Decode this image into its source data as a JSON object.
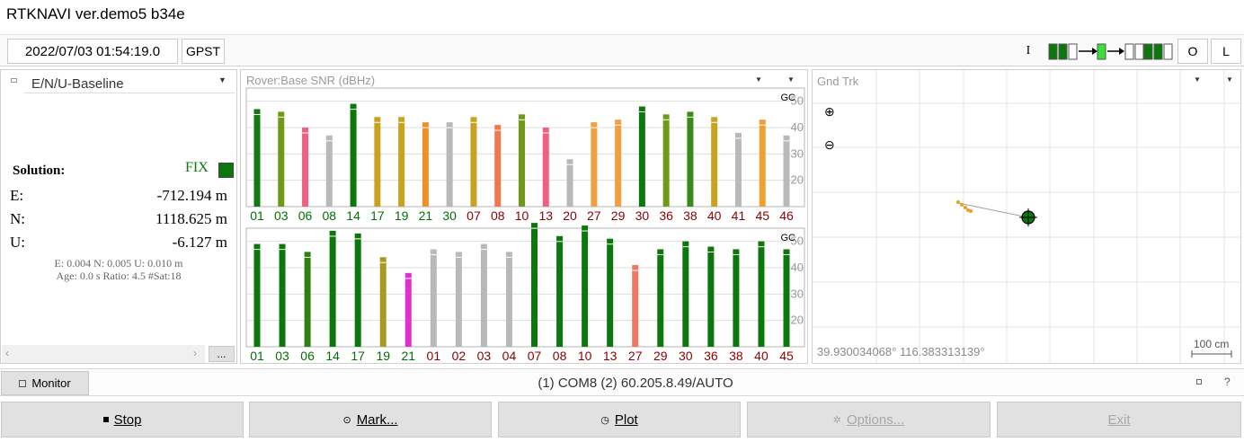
{
  "window": {
    "title": "RTKNAVI ver.demo5 b34e"
  },
  "toolbar": {
    "datetime": "2022/07/03 01:54:19.0",
    "time_system": "GPST",
    "input_label": "I",
    "output_label": "O",
    "log_label": "L"
  },
  "left_panel": {
    "mode": "E/N/U-Baseline",
    "solution_label": "Solution:",
    "status": "FIX",
    "status_color": "#008000",
    "rows": [
      {
        "label": "E:",
        "value": "-712.194 m"
      },
      {
        "label": "N:",
        "value": "1118.625 m"
      },
      {
        "label": "U:",
        "value": "-6.127 m"
      }
    ],
    "stats1": "E: 0.004 N: 0.005 U: 0.010 m",
    "stats2": "Age: 0.0 s Ratio: 4.5 #Sat:18",
    "more_button": "..."
  },
  "snr_panel": {
    "title": "Rover:Base  SNR (dBHz)",
    "chart_data": [
      {
        "type": "bar",
        "title": "GC",
        "ylim": [
          10,
          55
        ],
        "yticks": [
          20,
          30,
          40,
          50
        ],
        "categories": [
          "01",
          "03",
          "06",
          "08",
          "14",
          "17",
          "19",
          "21",
          "30",
          "07",
          "08",
          "10",
          "13",
          "20",
          "27",
          "29",
          "30",
          "36",
          "38",
          "40",
          "41",
          "45",
          "46"
        ],
        "label_colors": [
          "#007000",
          "#007000",
          "#007000",
          "#007000",
          "#007000",
          "#007000",
          "#007000",
          "#007000",
          "#007000",
          "#8b0000",
          "#8b0000",
          "#8b0000",
          "#8b0000",
          "#8b0000",
          "#8b0000",
          "#8b0000",
          "#8b0000",
          "#8b0000",
          "#8b0000",
          "#8b0000",
          "#8b0000",
          "#8b0000",
          "#8b0000"
        ],
        "values": [
          47,
          46,
          40,
          37,
          49,
          44,
          44,
          42,
          42,
          44,
          41,
          45,
          40,
          28,
          42,
          43,
          48,
          45,
          46,
          44,
          38,
          43,
          37
        ],
        "bar_colors": [
          "#127812",
          "#6f9a18",
          "#f06080",
          "#b9b9b9",
          "#0a780a",
          "#c9a21e",
          "#c9a21e",
          "#f0902a",
          "#b9b9b9",
          "#c9a21e",
          "#f07850",
          "#6f9a18",
          "#f06080",
          "#b9b9b9",
          "#f0a040",
          "#f0a040",
          "#0a780a",
          "#6f9a18",
          "#3a8a1a",
          "#c9a21e",
          "#b9b9b9",
          "#f0a030",
          "#b9b9b9"
        ]
      },
      {
        "type": "bar",
        "title": "GC",
        "ylim": [
          10,
          55
        ],
        "yticks": [
          20,
          30,
          40,
          50
        ],
        "categories": [
          "01",
          "03",
          "06",
          "14",
          "17",
          "19",
          "21",
          "01",
          "02",
          "03",
          "04",
          "07",
          "08",
          "10",
          "13",
          "27",
          "29",
          "30",
          "36",
          "38",
          "40",
          "45"
        ],
        "label_colors": [
          "#007000",
          "#007000",
          "#007000",
          "#007000",
          "#007000",
          "#007000",
          "#007000",
          "#8b0000",
          "#8b0000",
          "#8b0000",
          "#8b0000",
          "#8b0000",
          "#8b0000",
          "#8b0000",
          "#8b0000",
          "#8b0000",
          "#8b0000",
          "#8b0000",
          "#8b0000",
          "#8b0000",
          "#8b0000",
          "#8b0000"
        ],
        "values": [
          49,
          49,
          46,
          54,
          53,
          44,
          38,
          47,
          46,
          49,
          46,
          57,
          52,
          56,
          51,
          41,
          47,
          50,
          48,
          47,
          50,
          47
        ],
        "bar_colors": [
          "#0a780a",
          "#0a780a",
          "#2f7f12",
          "#0a780a",
          "#0a780a",
          "#a89a20",
          "#e030d0",
          "#b9b9b9",
          "#b9b9b9",
          "#b9b9b9",
          "#b9b9b9",
          "#0a780a",
          "#0a780a",
          "#0a780a",
          "#0a780a",
          "#f07860",
          "#0a780a",
          "#0a780a",
          "#0a780a",
          "#0a780a",
          "#0a780a",
          "#0a780a"
        ]
      }
    ]
  },
  "track_panel": {
    "title": "Gnd Trk",
    "coords": "39.930034068° 116.383313139°",
    "scale": "100 cm"
  },
  "status_bar": {
    "monitor_button": "Monitor",
    "connection": "(1) COM8 (2) 60.205.8.49/AUTO",
    "help": "?"
  },
  "buttons": {
    "stop": "Stop",
    "mark": "Mark...",
    "plot": "Plot",
    "options": "Options...",
    "exit": "Exit"
  }
}
